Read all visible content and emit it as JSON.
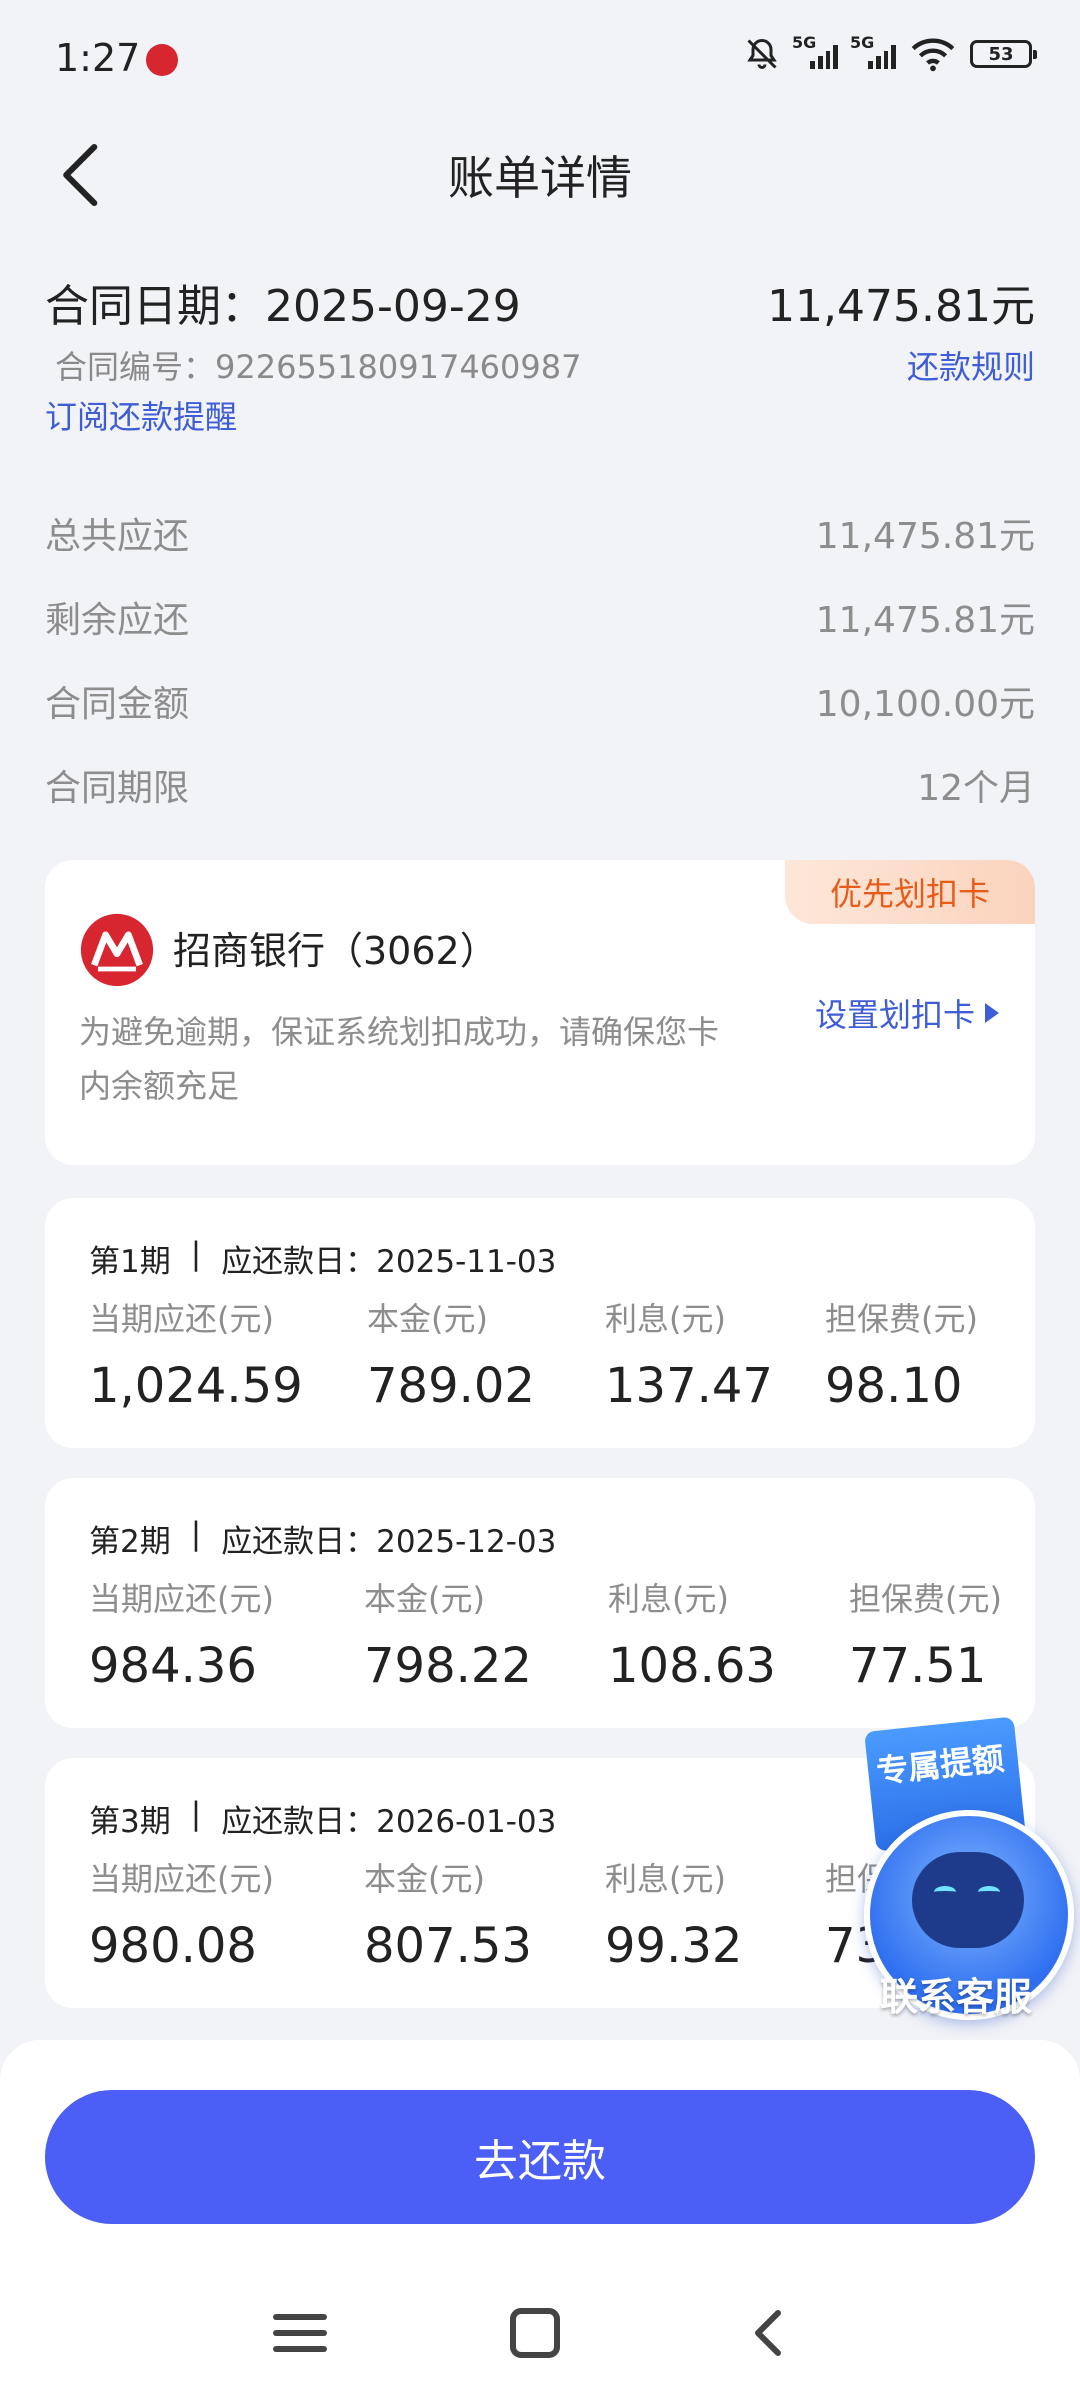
{
  "status_bar": {
    "time": "1:27",
    "network_1": "5G",
    "network_2": "5G",
    "battery": "53"
  },
  "header": {
    "title": "账单详情"
  },
  "summary": {
    "contract_date": "合同日期：2025-09-29",
    "amount": "11,475.81元",
    "contract_no": "合同编号：922655180917460987",
    "rules_link": "还款规则",
    "subscribe_link": "订阅还款提醒",
    "rows": [
      {
        "label": "总共应还",
        "value": "11,475.81元"
      },
      {
        "label": "剩余应还",
        "value": "11,475.81元"
      },
      {
        "label": "合同金额",
        "value": "10,100.00元"
      },
      {
        "label": "合同期限",
        "value": "12个月"
      }
    ]
  },
  "bank_card": {
    "badge": "优先划扣卡",
    "name": "招商银行（3062）",
    "note": "为避免逾期，保证系统划扣成功，请确保您卡内余额充足",
    "set_link": "设置划扣卡",
    "brand_color": "#d7262f"
  },
  "installments": [
    {
      "period": "第1期",
      "sep": "|",
      "due": "应还款日：2025-11-03",
      "cols": [
        {
          "label": "当期应还(元)",
          "value": "1,024.59"
        },
        {
          "label": "本金(元)",
          "value": "789.02"
        },
        {
          "label": "利息(元)",
          "value": "137.47"
        },
        {
          "label": "担保费(元)",
          "value": "98.10"
        }
      ]
    },
    {
      "period": "第2期",
      "sep": "|",
      "due": "应还款日：2025-12-03",
      "cols": [
        {
          "label": "当期应还(元)",
          "value": "984.36"
        },
        {
          "label": "本金(元)",
          "value": "798.22"
        },
        {
          "label": "利息(元)",
          "value": "108.63"
        },
        {
          "label": "担保费(元)",
          "value": "77.51"
        }
      ]
    },
    {
      "period": "第3期",
      "sep": "|",
      "due": "应还款日：2026-01-03",
      "cols": [
        {
          "label": "当期应还(元)",
          "value": "980.08"
        },
        {
          "label": "本金(元)",
          "value": "807.53"
        },
        {
          "label": "利息(元)",
          "value": "99.32"
        },
        {
          "label": "担保费(元)",
          "value": "73"
        }
      ]
    }
  ],
  "float_service": {
    "promo": "专属提额",
    "label": "联系客服"
  },
  "pay_button": "去还款",
  "nav": {
    "menu_icon": "menu-icon",
    "home_icon": "home-icon",
    "back_icon": "back-icon"
  },
  "colors": {
    "accent": "#4b5ef5",
    "link": "#3f5dd7",
    "badge_text": "#e85c1a"
  }
}
